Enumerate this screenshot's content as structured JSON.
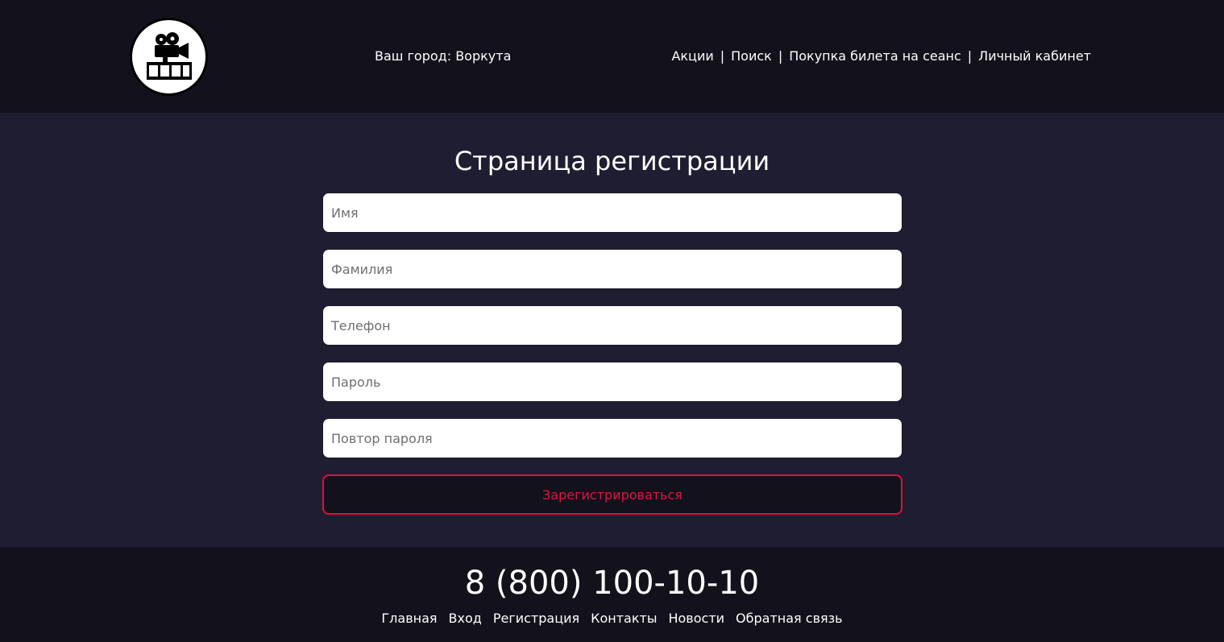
{
  "header": {
    "logo_icon": "film-camera-icon",
    "city_text": "Ваш город: Воркута",
    "nav": [
      {
        "label": "Акции"
      },
      {
        "label": "Поиск"
      },
      {
        "label": "Покупка билета на сеанс"
      },
      {
        "label": "Личный кабинет"
      }
    ],
    "separator": "|"
  },
  "main": {
    "title": "Страница регистрации",
    "fields": {
      "first_name": {
        "placeholder": "Имя",
        "value": ""
      },
      "last_name": {
        "placeholder": "Фамилия",
        "value": ""
      },
      "phone": {
        "placeholder": "Телефон",
        "value": ""
      },
      "password": {
        "placeholder": "Пароль",
        "value": ""
      },
      "password_repeat": {
        "placeholder": "Повтор пароля",
        "value": ""
      }
    },
    "submit_label": "Зарегистрироваться"
  },
  "footer": {
    "phone": "8 (800) 100-10-10",
    "nav": [
      {
        "label": "Главная"
      },
      {
        "label": "Вход"
      },
      {
        "label": "Регистрация"
      },
      {
        "label": "Контакты"
      },
      {
        "label": "Новости"
      },
      {
        "label": "Обратная связь"
      }
    ]
  },
  "colors": {
    "header_bg": "#13121c",
    "main_bg": "#1f1d31",
    "accent": "#d9123e",
    "text": "#ffffff"
  }
}
